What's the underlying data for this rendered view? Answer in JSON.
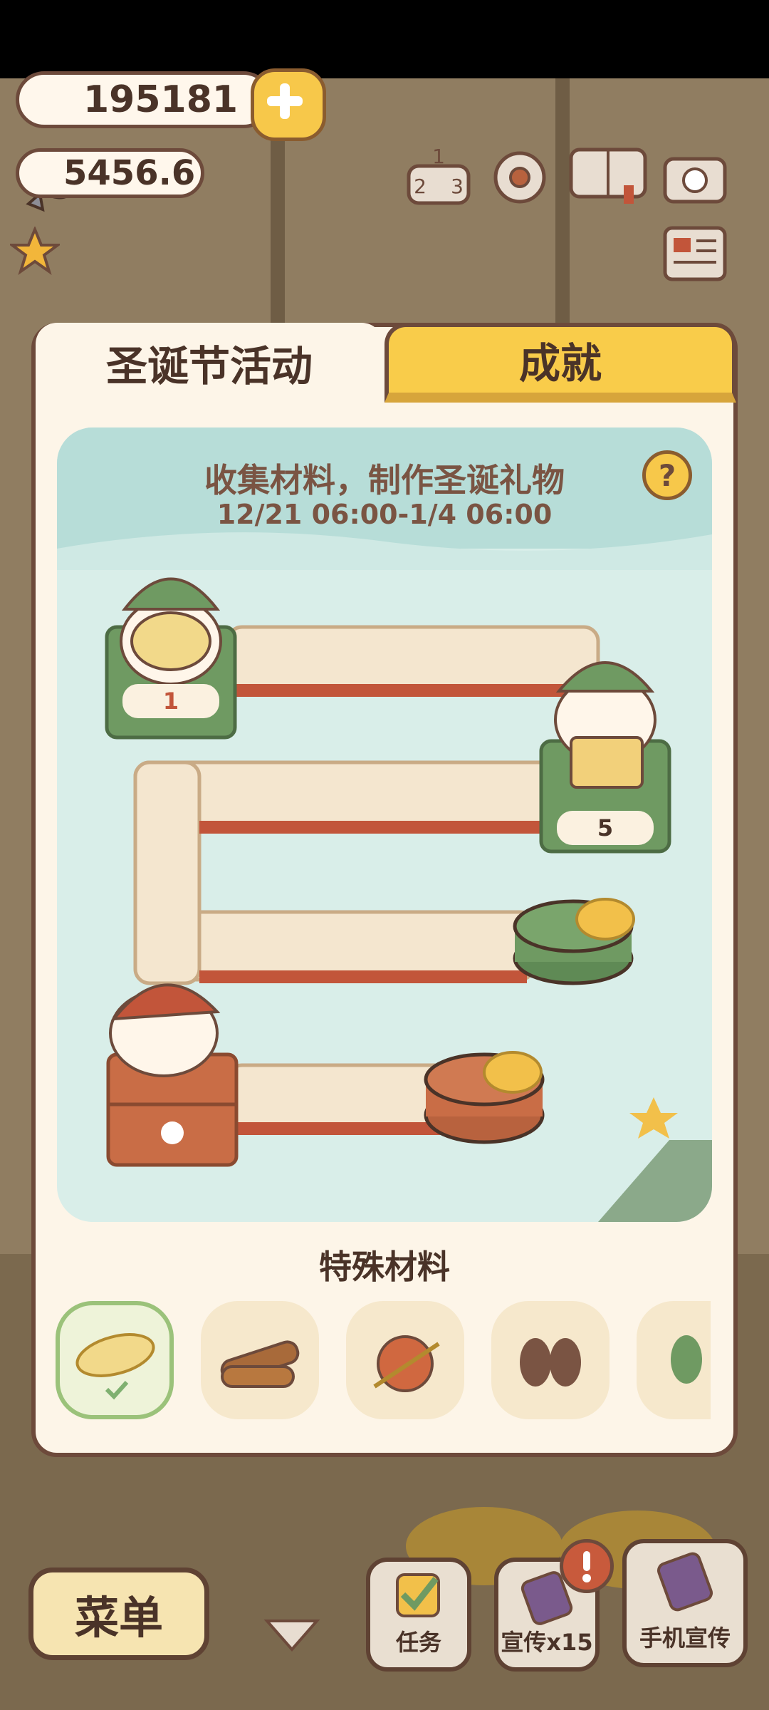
{
  "hud": {
    "fish_count": "195181",
    "star_count": "5456.6",
    "icons": [
      "fish-icon",
      "plus-icon",
      "star-icon",
      "leaderboard-icon",
      "settings-icon",
      "album-icon",
      "camera-icon",
      "newspaper-icon"
    ]
  },
  "tabs": {
    "christmas": "圣诞节活动",
    "achievement": "成就"
  },
  "event": {
    "title": "收集材料，制作圣诞礼物",
    "time": "12/21 06:00-1/4 06:00",
    "help": "?",
    "node_1_count": "1",
    "node_5_count": "5"
  },
  "materials": {
    "title": "特殊材料",
    "items": [
      "straw-bundle-icon",
      "firewood-icon",
      "yarn-ball-icon",
      "mittens-icon",
      "leaf-icon"
    ]
  },
  "bottom": {
    "menu": "菜单",
    "task": "任务",
    "promo": "宣传x15",
    "phone_promo": "手机宣传"
  },
  "colors": {
    "tab_active": "#fdf5e8",
    "tab_inactive": "#f9cc4a",
    "card_bg": "#d9eee9",
    "brown": "#6d4a3b"
  }
}
